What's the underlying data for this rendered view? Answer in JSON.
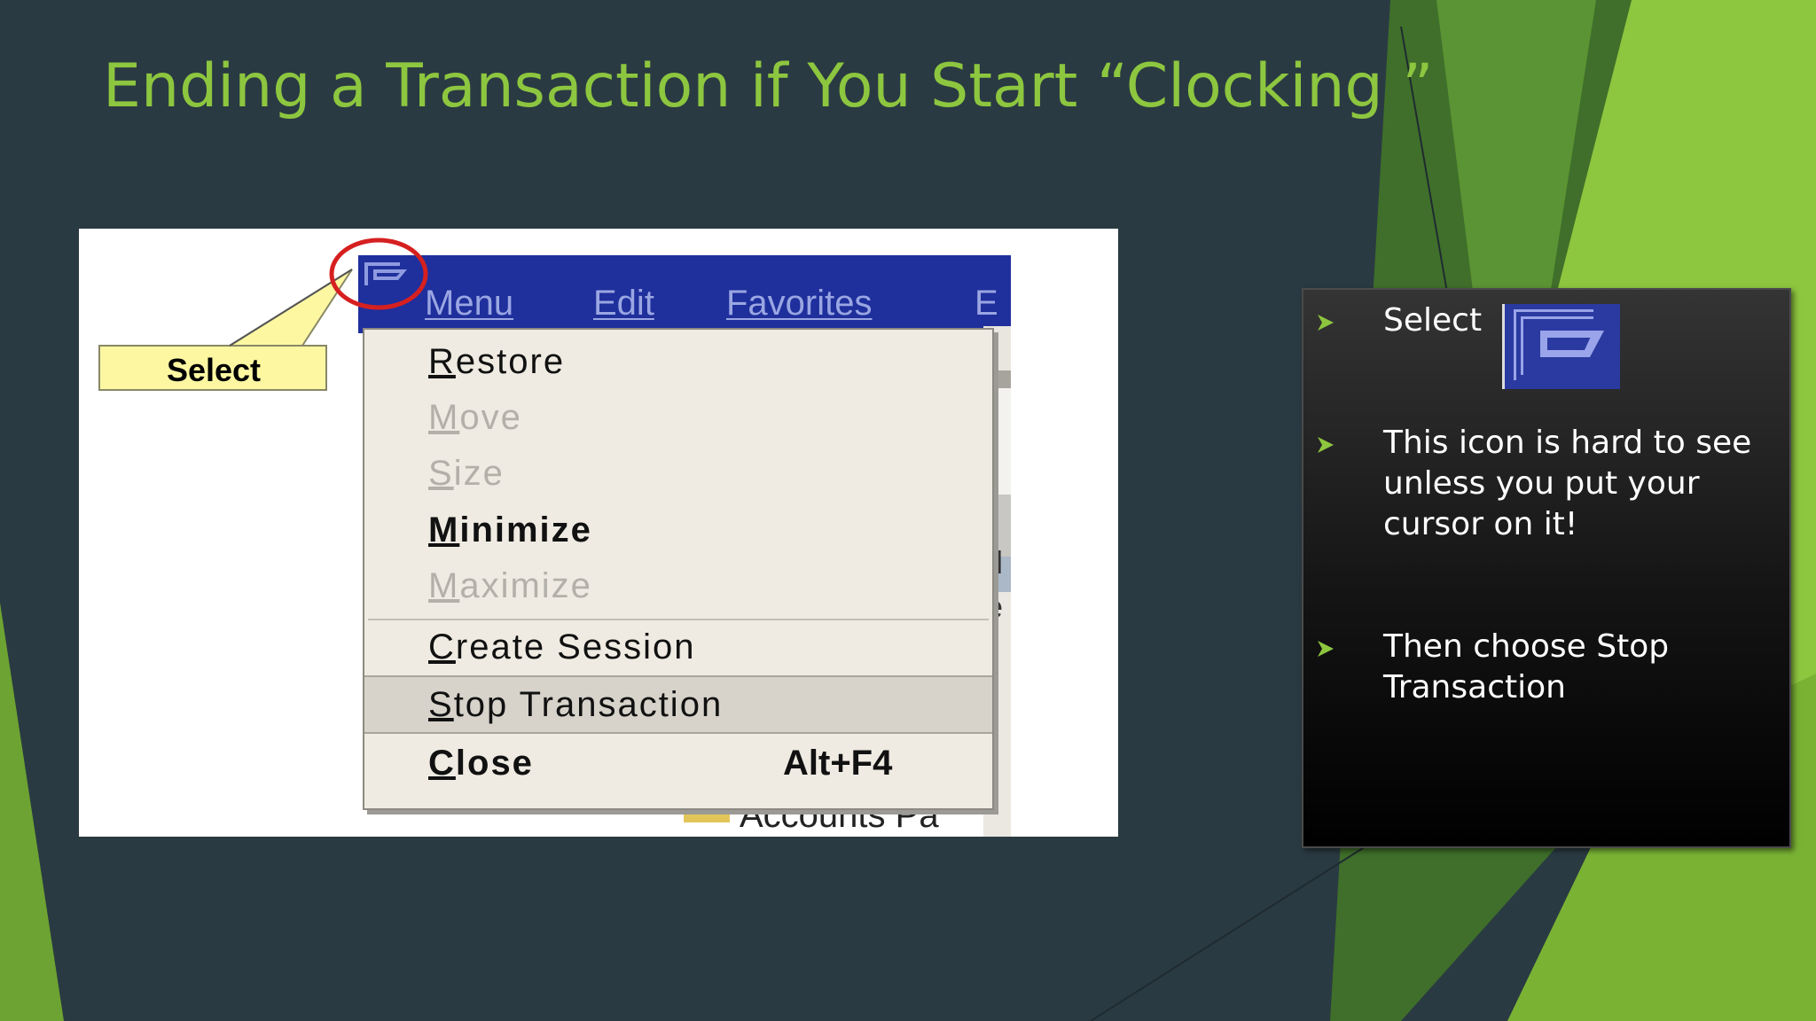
{
  "slide": {
    "title": "Ending a Transaction if You Start “Clocking ”"
  },
  "screenshot": {
    "callout_label": "Select",
    "menubar": [
      {
        "label": "Menu"
      },
      {
        "label": "Edit"
      },
      {
        "label": "Favorites"
      },
      {
        "label": "E"
      }
    ],
    "system_menu": {
      "items": [
        {
          "label": "Restore",
          "state": "enabled"
        },
        {
          "label": "Move",
          "state": "disabled"
        },
        {
          "label": "Size",
          "state": "disabled"
        },
        {
          "label": "Minimize",
          "state": "enabled"
        },
        {
          "label": "Maximize",
          "state": "disabled"
        },
        {
          "label": "Create Session",
          "state": "enabled"
        },
        {
          "label": "Stop Transaction",
          "state": "highlighted"
        },
        {
          "label": "Close",
          "shortcut": "Alt+F4",
          "state": "enabled"
        }
      ]
    },
    "bottom_text": "Accounts Pa",
    "icon": "system-menu-icon"
  },
  "info_panel": {
    "bullets": [
      {
        "text": "Select"
      },
      {
        "text": "This icon is hard to see unless you put your cursor on it!"
      },
      {
        "text": "Then choose Stop Transaction"
      }
    ],
    "icon": "system-menu-icon"
  },
  "colors": {
    "background": "#2a3a42",
    "title": "#8dc63f",
    "accent_green": "#8dc63f",
    "window_titlebar": "#1f2f9c",
    "callout_fill": "#fdf7a2",
    "selection_ring": "#d62020",
    "panel_background": "#000000"
  }
}
